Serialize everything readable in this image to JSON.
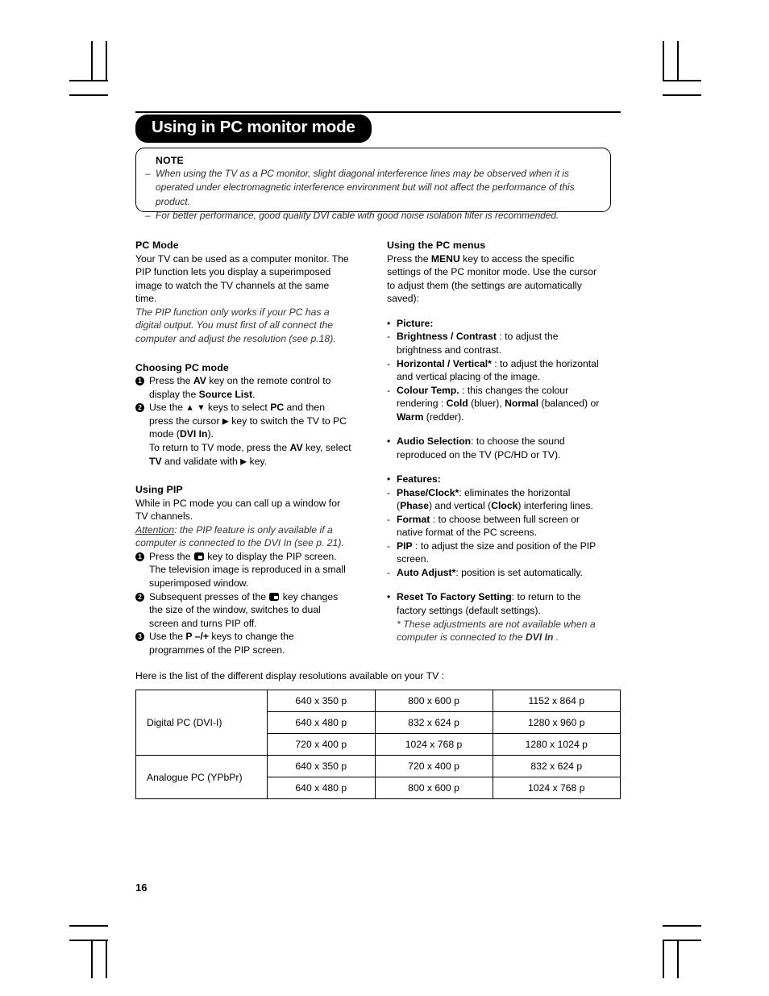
{
  "header": {
    "title": "Using in PC monitor mode"
  },
  "note": {
    "label": "NOTE",
    "dash": "–",
    "lines": [
      "When using the TV as a PC monitor, slight diagonal interference lines may be observed when it is operated under electromagnetic interference environment but will not affect the performance of this product.",
      "For better performance, good quality DVI cable with good noise isolation filter is recommended."
    ]
  },
  "left_column": {
    "pc_mode": {
      "heading": "PC Mode",
      "body": "Your TV can be used as a computer monitor. The PIP function lets you display a superimposed image to watch the TV channels at the same time.",
      "italic_note": "The PIP function only works if your PC has a digital output. You must first of all connect the computer and adjust the resolution (see p.18)."
    },
    "choosing": {
      "heading": "Choosing PC mode",
      "step1_num": "1",
      "step1_a": "Press the ",
      "step1_av": "AV",
      "step1_b": " key on the remote control to display the ",
      "step1_src": "Source List",
      "step1_c": ".",
      "step2_num": "2",
      "step2_a": "Use the ",
      "step2_up": "▲",
      "step2_dn": "▼",
      "step2_b": " keys to select ",
      "step2_pc": "PC",
      "step2_c": " and then press the cursor ",
      "step2_right": "▶",
      "step2_d": " key to switch the TV to PC mode (",
      "step2_dvi": "DVI In",
      "step2_e": ").",
      "step2_f": "To return to TV mode, press the ",
      "step2_av": "AV",
      "step2_g": " key, select ",
      "step2_tv": "TV",
      "step2_h": " and validate with ",
      "step2_right2": "▶",
      "step2_i": " key."
    },
    "pip": {
      "heading": "Using PIP",
      "body": "While in PC mode you can call up a window for TV channels.",
      "attention_label": "Attention",
      "attention_text": ": the PIP feature is only available if a computer is connected to the DVI In (see p. 21).",
      "step1_num": "1",
      "step1_a": "Press the ",
      "step1_b": " key to display the PIP screen. The television image is reproduced in a small superimposed window.",
      "step2_num": "2",
      "step2_a": "Subsequent presses of the ",
      "step2_b": " key changes the size of the window, switches to dual screen and turns PIP off.",
      "step3_num": "3",
      "step3_a": "Use the ",
      "step3_p": "P –/+",
      "step3_b": " keys to change the programmes of the PIP screen."
    }
  },
  "right_column": {
    "menus": {
      "heading": "Using the PC menus",
      "body_a": "Press the ",
      "body_menu": "MENU",
      "body_b": " key to access the specific settings of the PC monitor mode. Use the cursor to adjust them (the settings are automatically saved):"
    },
    "bullet": "•",
    "dash": "-",
    "picture": {
      "label": "Picture:",
      "items": [
        {
          "bold": "Brightness / Contrast",
          "rest": " : to adjust the brightness and contrast."
        },
        {
          "bold": "Horizontal / Vertical*",
          "rest": " : to adjust the horizontal and vertical placing of the image."
        },
        {
          "bold": "Colour Temp.",
          "rest_a": "  :  this changes the colour rendering : ",
          "cold": "Cold",
          "rest_b": " (bluer), ",
          "normal": "Normal",
          "rest_c": " (balanced) or ",
          "warm": "Warm",
          "rest_d": " (redder)."
        }
      ]
    },
    "audio": {
      "bold": "Audio Selection",
      "rest": ": to choose the sound reproduced on the TV (PC/HD or TV)."
    },
    "features": {
      "label": "Features:",
      "items": [
        {
          "bold": "Phase/Clock*",
          "rest_a": ": eliminates the horizontal (",
          "phase": "Phase",
          "rest_b": ") and vertical (",
          "clock": "Clock",
          "rest_c": ") interfering lines."
        },
        {
          "bold": "Format",
          "rest": " : to choose between full screen or native format of the PC screens."
        },
        {
          "bold": "PIP",
          "rest": " : to adjust the size and position of the PIP screen."
        },
        {
          "bold": "Auto Adjust*",
          "rest": ": position is set automatically."
        }
      ]
    },
    "reset": {
      "bold": "Reset To Factory Setting",
      "rest": ": to return to the factory settings (default settings).",
      "footnote_a": "* These adjustments are not available when a computer is connected to the ",
      "footnote_dvi": "DVI In",
      "footnote_b": " ."
    }
  },
  "table": {
    "intro": "Here is the list of the different display resolutions available on your TV :",
    "rows": [
      {
        "head": "Digital PC (DVI-I)",
        "span": 3,
        "cells": [
          "640 x 350 p",
          "800 x 600 p",
          "1152 x 864 p"
        ]
      },
      {
        "head": null,
        "cells": [
          "640 x 480 p",
          "832 x 624 p",
          "1280 x 960 p"
        ]
      },
      {
        "head": null,
        "cells": [
          "720 x 400 p",
          "1024 x 768 p",
          "1280 x 1024 p"
        ]
      },
      {
        "head": "Analogue PC (YPbPr)",
        "span": 2,
        "cells": [
          "640 x 350 p",
          "720 x 400 p",
          "832 x 624 p"
        ]
      },
      {
        "head": null,
        "cells": [
          "640 x 480 p",
          "800 x 600 p",
          "1024 x 768 p"
        ]
      }
    ]
  },
  "footer": {
    "page_number": "16"
  }
}
